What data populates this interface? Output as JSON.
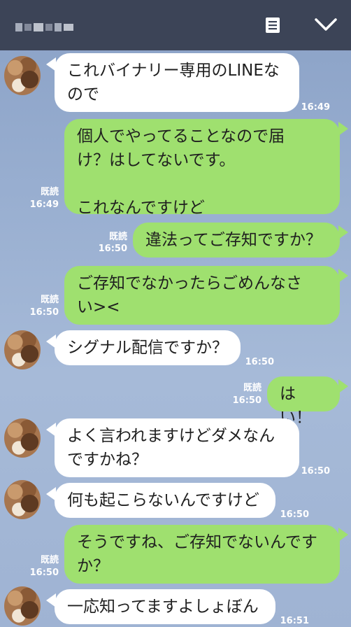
{
  "header": {
    "title": "▒▒▒▒"
  },
  "messages": [
    {
      "side": "in",
      "text": "これバイナリー専用のLINEな\nので",
      "time": "16:49"
    },
    {
      "side": "out",
      "text": "個人でやってることなので届\nけ？はしてないです。\n\nこれなんですけど",
      "read": "既読",
      "time": "16:49"
    },
    {
      "side": "out",
      "text": "違法ってご存知ですか？",
      "read": "既読",
      "time": "16:50"
    },
    {
      "side": "out",
      "text": "ご存知でなかったらごめんなさ\nい><",
      "read": "既読",
      "time": "16:50"
    },
    {
      "side": "in",
      "text": "シグナル配信ですか？",
      "time": "16:50"
    },
    {
      "side": "out",
      "text": "はい！",
      "read": "既読",
      "time": "16:50"
    },
    {
      "side": "in",
      "text": "よく言われますけどダメなん\nですかね？",
      "time": "16:50"
    },
    {
      "side": "in",
      "text": "何も起こらないんですけど",
      "time": "16:50"
    },
    {
      "side": "out",
      "text": "そうですね、ご存知でないんです\nか？",
      "read": "既読",
      "time": "16:50"
    },
    {
      "side": "in",
      "text": "一応知ってますよしょぼん",
      "time": "16:51"
    }
  ]
}
